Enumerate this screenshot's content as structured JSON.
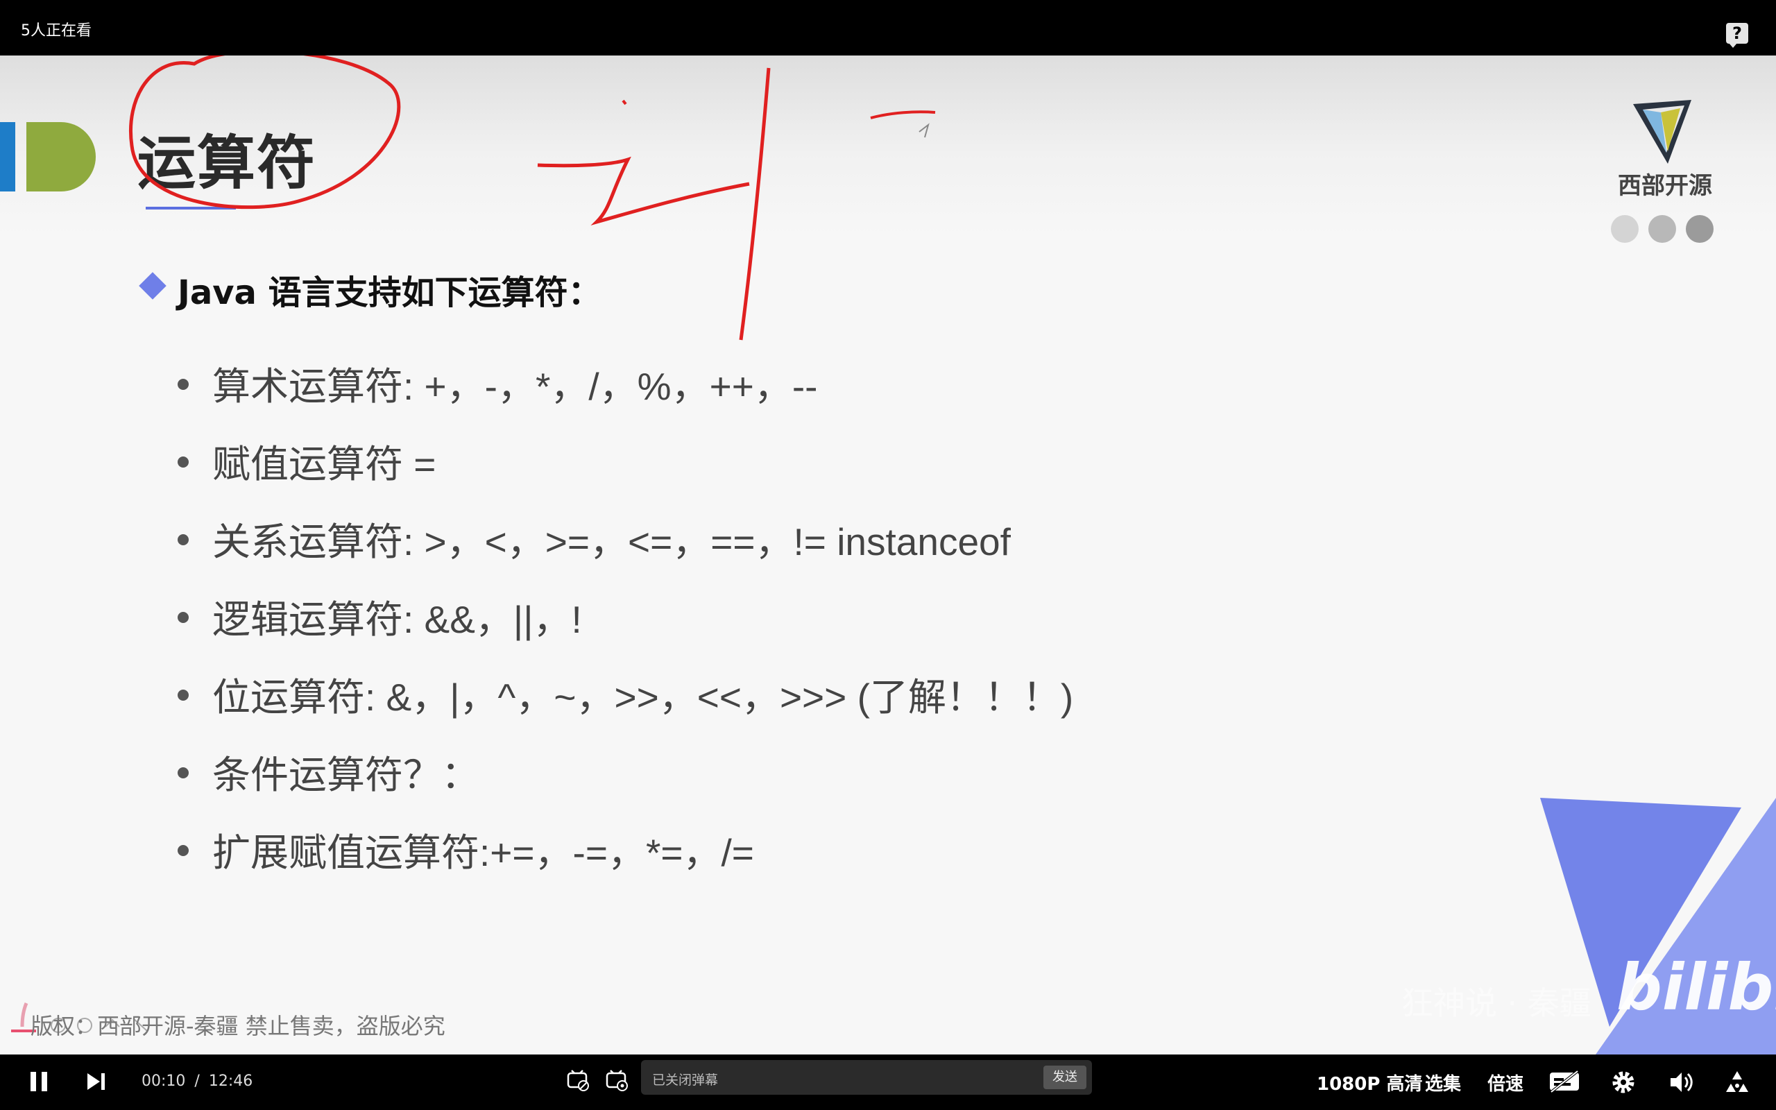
{
  "top_bar": {
    "viewer_count": "5人正在看"
  },
  "slide": {
    "title": "运算符",
    "brand_name": "西部开源",
    "heading": "Java 语言支持如下运算符：",
    "bullets": [
      "算术运算符: +，-，*，/，%，++，--",
      "赋值运算符 =",
      "关系运算符: >，<，>=，<=，==，!= instanceof",
      "逻辑运算符: &&，||，!",
      "位运算符: &，|，^，~，>>，<<，>>> (了解！！！)",
      "条件运算符？：",
      "扩展赋值运算符:+=，-=，*=，/="
    ],
    "watermark": "版权：西部开源-秦疆    禁止售卖，盗版必究",
    "bili_overlay_text": "bilibili",
    "bili_faded_text": "狂神说 · 秦疆"
  },
  "controls": {
    "current_time": "00:10",
    "separator": "/",
    "duration": "12:46",
    "danmaku_placeholder": "已关闭弹幕",
    "send_label": "发送",
    "quality": "1080P 高清",
    "episodes": "选集",
    "speed": "倍速"
  },
  "icons": [
    "help-icon",
    "pause-icon",
    "next-icon",
    "danmaku-toggle-icon",
    "danmaku-settings-icon",
    "subtitle-icon",
    "settings-gear-icon",
    "volume-icon",
    "fullscreen-icon"
  ],
  "colors": {
    "accent_blue": "#6f7fe8",
    "annotation_red": "#e02020",
    "bili_purple": "#6b7de8"
  }
}
